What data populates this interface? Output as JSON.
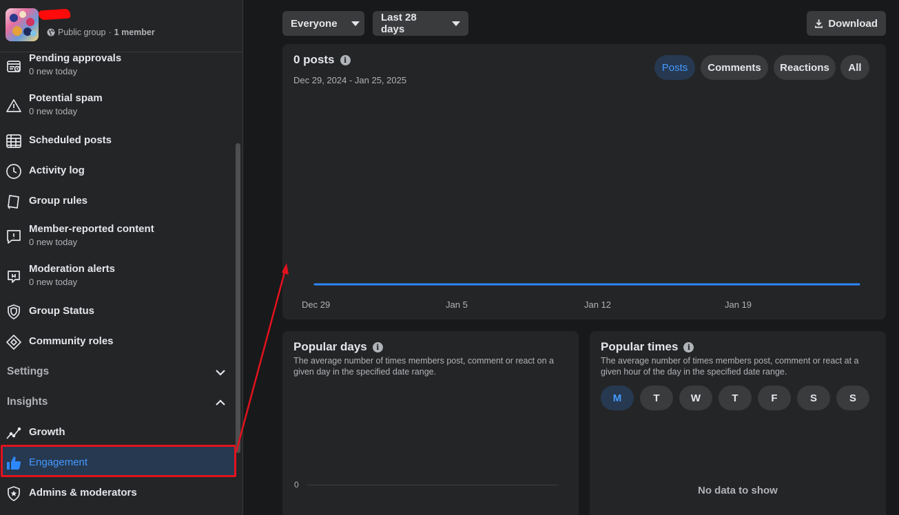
{
  "group": {
    "privacy": "Public group",
    "separator": "·",
    "members": "1 member"
  },
  "sidebar": {
    "items": [
      {
        "label": "Pending approvals",
        "sub": "0 new today"
      },
      {
        "label": "Potential spam",
        "sub": "0 new today"
      },
      {
        "label": "Scheduled posts"
      },
      {
        "label": "Activity log"
      },
      {
        "label": "Group rules"
      },
      {
        "label": "Member-reported content",
        "sub": "0 new today"
      },
      {
        "label": "Moderation alerts",
        "sub": "0 new today"
      },
      {
        "label": "Group Status"
      },
      {
        "label": "Community roles"
      }
    ],
    "settings_label": "Settings",
    "insights_label": "Insights",
    "insights_items": [
      {
        "label": "Growth"
      },
      {
        "label": "Engagement",
        "selected": true
      },
      {
        "label": "Admins & moderators"
      }
    ]
  },
  "filters": {
    "audience": "Everyone",
    "range": "Last 28 days",
    "download": "Download"
  },
  "posts_card": {
    "title": "0 posts",
    "date_range": "Dec 29, 2024 - Jan 25, 2025",
    "tabs": [
      "Posts",
      "Comments",
      "Reactions",
      "All"
    ],
    "active_tab": "Posts",
    "x_labels": [
      "Dec 29",
      "Jan 5",
      "Jan 12",
      "Jan 19"
    ]
  },
  "chart_data": {
    "type": "line",
    "x": [
      "Dec 29",
      "Jan 5",
      "Jan 12",
      "Jan 19"
    ],
    "series": [
      {
        "values": [
          0,
          0,
          0,
          0
        ]
      }
    ],
    "title": "0 posts",
    "color": "#2d88ff"
  },
  "popular_days": {
    "title": "Popular days",
    "description": "The average number of times members post, comment or react on a given day in the specified date range.",
    "y_label": "0"
  },
  "popular_times": {
    "title": "Popular times",
    "description": "The average number of times members post, comment or react at a given hour of the day in the specified date range.",
    "days": [
      "M",
      "T",
      "W",
      "T",
      "F",
      "S",
      "S"
    ],
    "active_day": "M",
    "empty_text": "No data to show"
  },
  "colors": {
    "accent": "#2d88ff",
    "selected_bg": "#263951",
    "annotation": "#e3121e"
  }
}
